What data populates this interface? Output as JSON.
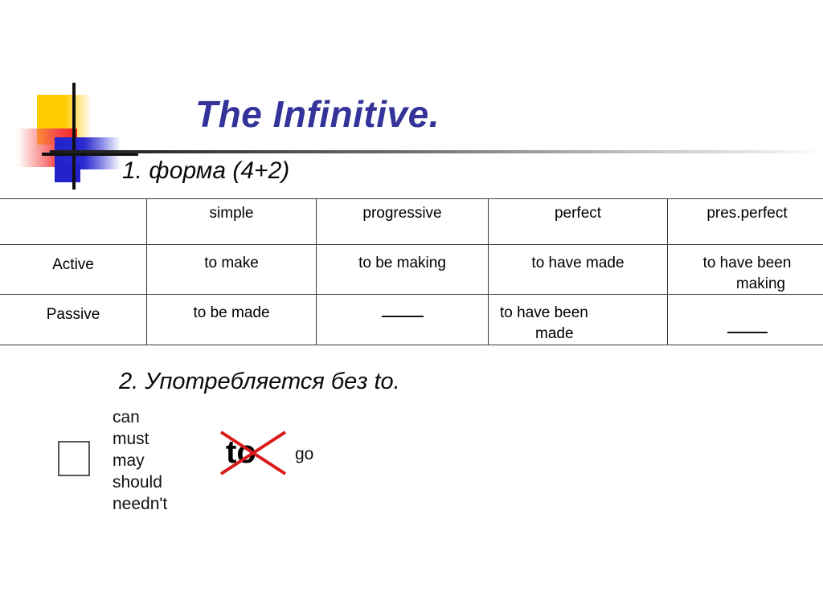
{
  "slide": {
    "title": "The Infinitive.",
    "title_color": "#33339A",
    "section1_heading": "1. форма (4+2)",
    "section2_heading": "2. Употребляется без to."
  },
  "logo": {
    "colors": {
      "yellow": "#FFCC00",
      "red": "#F22020",
      "blue": "#2222CC",
      "cross": "#111111"
    }
  },
  "table": {
    "headers": [
      "",
      "simple",
      "progressive",
      "perfect",
      "pres.perfect"
    ],
    "rows": [
      {
        "label": "Active",
        "cells": [
          {
            "line1": "to make",
            "line2": ""
          },
          {
            "line1": "to be making",
            "line2": ""
          },
          {
            "line1": "to have made",
            "line2": ""
          },
          {
            "line1": "to have been",
            "line2": "making"
          }
        ]
      },
      {
        "label": "Passive",
        "cells": [
          {
            "line1": "to be made",
            "line2": ""
          },
          {
            "line1": "—",
            "line2": ""
          },
          {
            "line1": "to have been",
            "line2": "made"
          },
          {
            "line1": "—",
            "line2": ""
          }
        ]
      }
    ]
  },
  "modals": {
    "items": [
      "can",
      "must",
      "may",
      "should",
      "needn't"
    ],
    "crossed_word": "to",
    "verb": "go",
    "cross_color": "#D81A1A"
  }
}
